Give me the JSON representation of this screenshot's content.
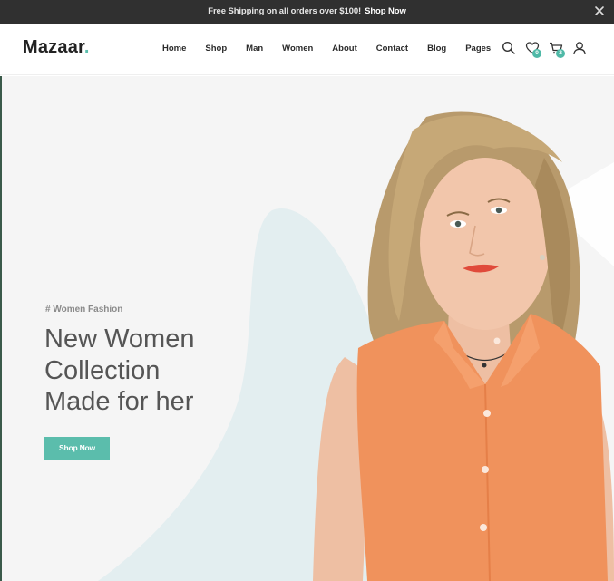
{
  "announcement": {
    "text": "Free Shipping on all orders over $100!",
    "link_label": "Shop Now"
  },
  "header": {
    "logo_text": "Mazaar",
    "logo_dot": ".",
    "nav": [
      "Home",
      "Shop",
      "Man",
      "Women",
      "About",
      "Contact",
      "Blog",
      "Pages"
    ],
    "wishlist_count": "0",
    "cart_count": "2"
  },
  "hero": {
    "tag": "# Women Fashion",
    "headline": [
      "New Women",
      "Collection",
      "Made for her"
    ],
    "button_label": "Shop Now"
  },
  "colors": {
    "accent": "#5bbdac",
    "topbar": "#303030",
    "blob": "#e3eef0",
    "shirt": "#f0925c"
  },
  "icons": [
    "close-icon",
    "search-icon",
    "heart-icon",
    "cart-icon",
    "user-icon"
  ]
}
